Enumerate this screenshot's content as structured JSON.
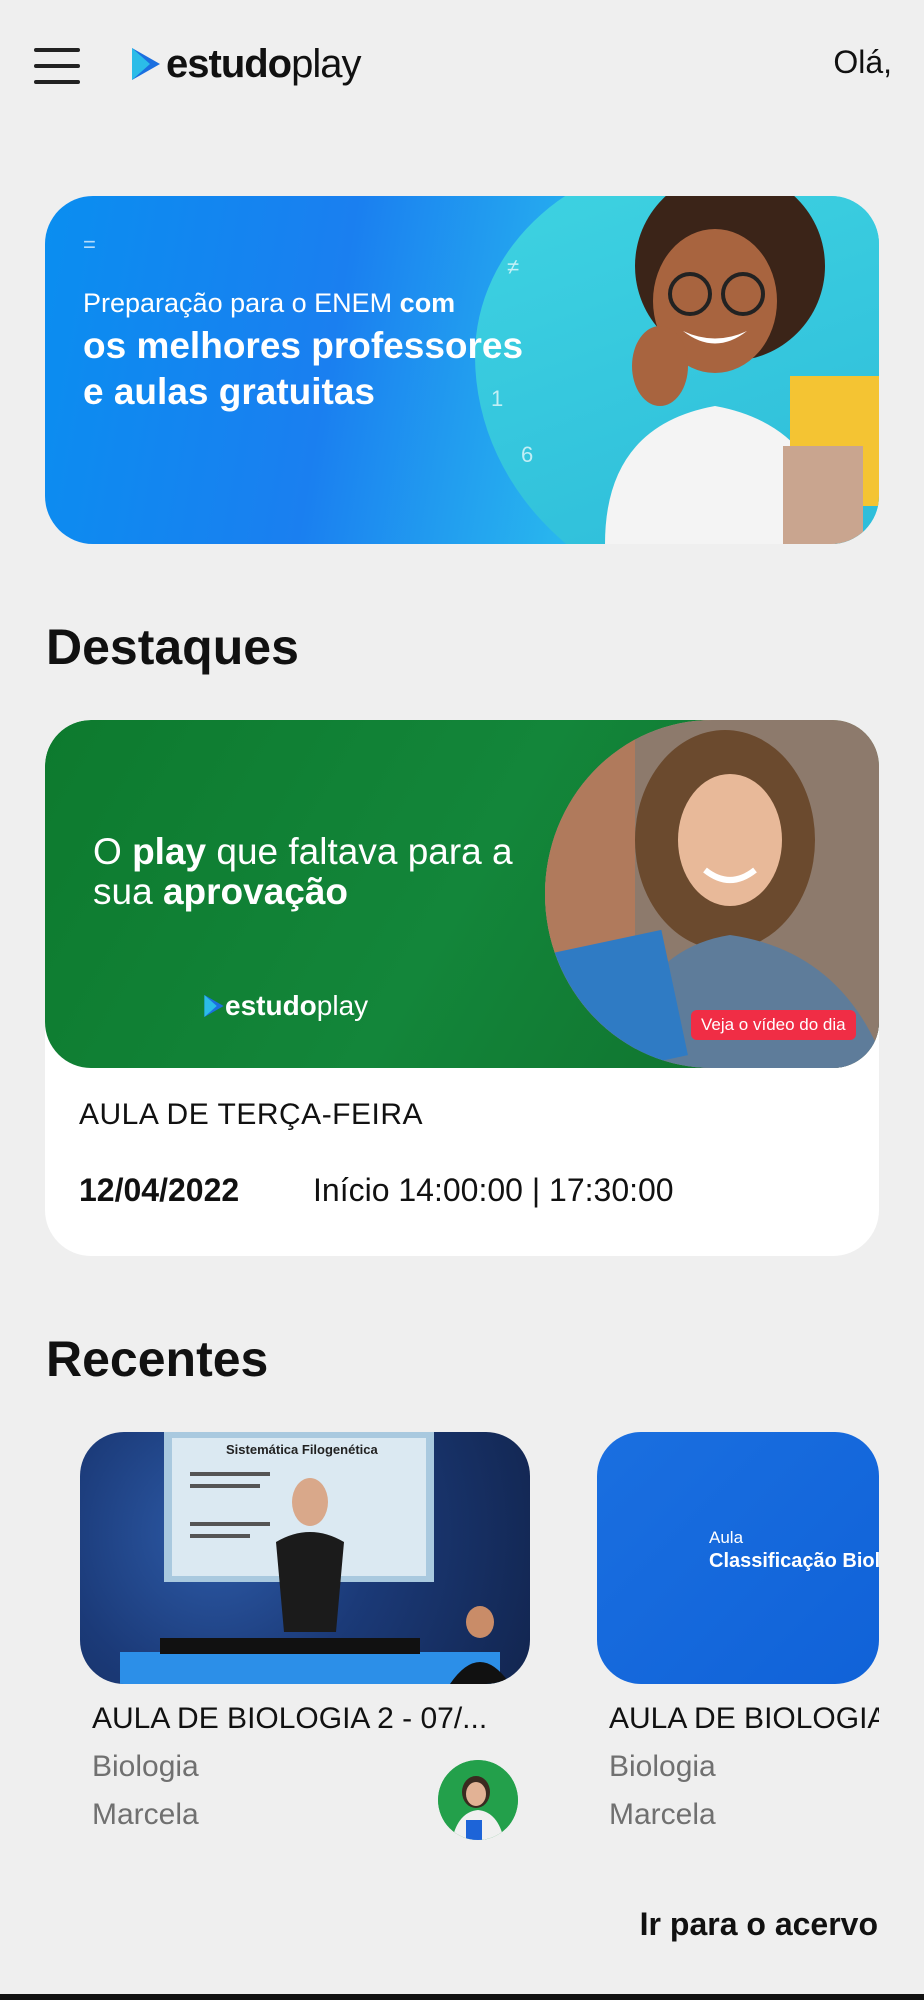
{
  "header": {
    "logo_bold": "estudo",
    "logo_light": "play",
    "greeting": "Olá,"
  },
  "hero": {
    "line1_regular": "Preparação para o ENEM ",
    "line1_bold": "com",
    "line2": "os melhores professores e aulas gratuitas"
  },
  "featured_section": {
    "title": "Destaques",
    "banner_prefix": "O ",
    "banner_bold1": "play",
    "banner_mid": " que faltava para a sua ",
    "banner_bold2": "aprovação",
    "banner_logo_bold": "estudo",
    "banner_logo_light": "play",
    "video_badge": "Veja o vídeo do dia",
    "day": "AULA DE TERÇA-FEIRA",
    "date": "12/04/2022",
    "time": "Início 14:00:00 | 17:30:00"
  },
  "recent_section": {
    "title": "Recentes",
    "cards": [
      {
        "title": "AULA DE BIOLOGIA 2 - 07/...",
        "subject": "Biologia",
        "teacher": "Marcela",
        "thumb_heading": "Sistemática Filogenética"
      },
      {
        "title": "AULA DE BIOLOGIA",
        "subject": "Biologia",
        "teacher": "Marcela",
        "thumb_small": "Aula",
        "thumb_heading": "Classificação Biol"
      }
    ]
  },
  "footer": {
    "go_acervo": "Ir para o acervo"
  },
  "colors": {
    "hero_blue": "#1a7ff0",
    "featured_green": "#13863a",
    "badge_red": "#f02d45"
  }
}
